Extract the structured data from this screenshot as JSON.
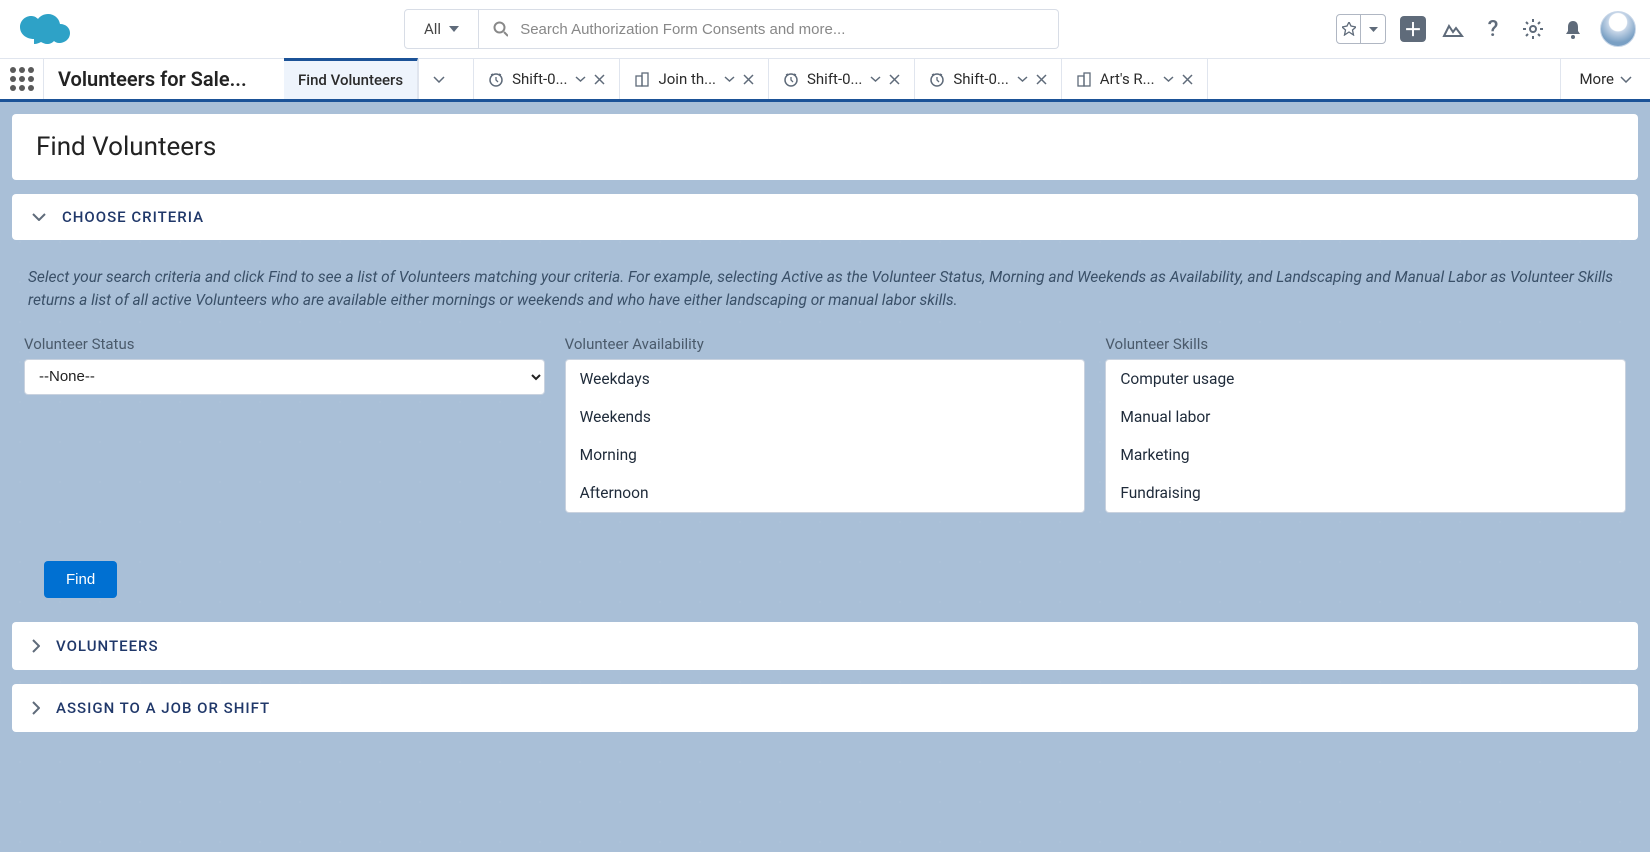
{
  "header": {
    "search_scope": "All",
    "search_placeholder": "Search Authorization Form Consents and more..."
  },
  "nav": {
    "app_name": "Volunteers for Sale...",
    "active_tab": "Find Volunteers",
    "tabs": [
      {
        "label": "Shift-0...",
        "icon": "clock"
      },
      {
        "label": "Join th...",
        "icon": "building"
      },
      {
        "label": "Shift-0...",
        "icon": "clock"
      },
      {
        "label": "Shift-0...",
        "icon": "clock"
      },
      {
        "label": "Art's R...",
        "icon": "building"
      }
    ],
    "more_label": "More"
  },
  "page": {
    "title": "Find Volunteers"
  },
  "criteria": {
    "section_title": "CHOOSE CRITERIA",
    "help_text": "Select your search criteria and click Find to see a list of Volunteers matching your criteria. For example, selecting Active as the Volunteer Status, Morning and Weekends as Availability, and Landscaping and Manual Labor as Volunteer Skills returns a list of all active Volunteers who are available either mornings or weekends and who have either landscaping or manual labor skills.",
    "status_label": "Volunteer Status",
    "status_value": "--None--",
    "availability_label": "Volunteer Availability",
    "availability_options": [
      "Weekdays",
      "Weekends",
      "Morning",
      "Afternoon"
    ],
    "skills_label": "Volunteer Skills",
    "skills_options": [
      "Computer usage",
      "Manual labor",
      "Marketing",
      "Fundraising"
    ],
    "find_label": "Find"
  },
  "sections": {
    "volunteers": "VOLUNTEERS",
    "assign": "ASSIGN TO A JOB OR SHIFT"
  }
}
